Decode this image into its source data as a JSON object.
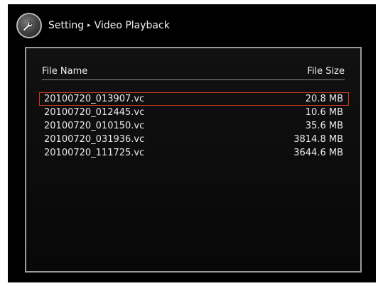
{
  "header": {
    "icon": "wrench-icon",
    "breadcrumb_parent": "Setting",
    "breadcrumb_separator": "▸",
    "breadcrumb_current": "Video Playback"
  },
  "file_list": {
    "columns": {
      "name": "File Name",
      "size": "File Size"
    },
    "selected_index": 0,
    "selection_color": "#c63a1f",
    "rows": [
      {
        "name": "20100720_013907.vc",
        "size": "20.8 MB"
      },
      {
        "name": "20100720_012445.vc",
        "size": "10.6 MB"
      },
      {
        "name": "20100720_010150.vc",
        "size": "35.6 MB"
      },
      {
        "name": "20100720_031936.vc",
        "size": "3814.8 MB"
      },
      {
        "name": "20100720_111725.vc",
        "size": "3644.6 MB"
      }
    ]
  }
}
